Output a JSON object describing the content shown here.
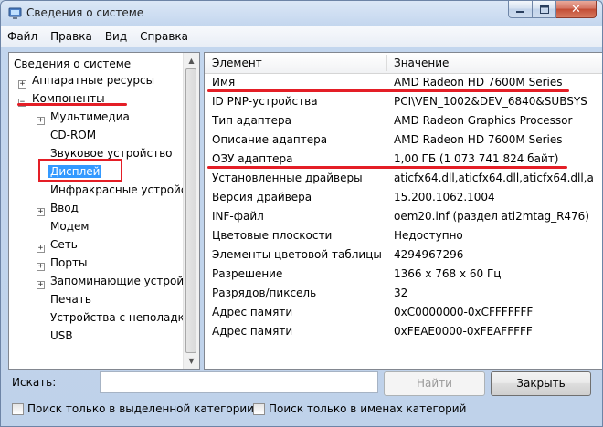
{
  "window": {
    "title": "Сведения о системе",
    "controls": {
      "close": "✕"
    }
  },
  "menu": [
    "Файл",
    "Правка",
    "Вид",
    "Справка"
  ],
  "tree": {
    "items": [
      {
        "label": "Сведения о системе",
        "level": 0,
        "expander": ""
      },
      {
        "label": "Аппаратные ресурсы",
        "level": 1,
        "expander": "+"
      },
      {
        "label": "Компоненты",
        "level": 1,
        "expander": "−"
      },
      {
        "label": "Мультимедиа",
        "level": 2,
        "expander": "+"
      },
      {
        "label": "CD-ROM",
        "level": 2,
        "expander": ""
      },
      {
        "label": "Звуковое устройство",
        "level": 2,
        "expander": ""
      },
      {
        "label": "Дисплей",
        "level": 2,
        "expander": "",
        "selected": true
      },
      {
        "label": "Инфракрасные устройст",
        "level": 2,
        "expander": ""
      },
      {
        "label": "Ввод",
        "level": 2,
        "expander": "+"
      },
      {
        "label": "Модем",
        "level": 2,
        "expander": ""
      },
      {
        "label": "Сеть",
        "level": 2,
        "expander": "+"
      },
      {
        "label": "Порты",
        "level": 2,
        "expander": "+"
      },
      {
        "label": "Запоминающие устройс",
        "level": 2,
        "expander": "+"
      },
      {
        "label": "Печать",
        "level": 2,
        "expander": ""
      },
      {
        "label": "Устройства с неполадка",
        "level": 2,
        "expander": ""
      },
      {
        "label": "USB",
        "level": 2,
        "expander": ""
      }
    ]
  },
  "table": {
    "columns": [
      "Элемент",
      "Значение"
    ],
    "rows": [
      {
        "item": "Имя",
        "value": "AMD Radeon HD 7600M Series"
      },
      {
        "item": "ID PNP-устройства",
        "value": "PCI\\VEN_1002&DEV_6840&SUBSYS"
      },
      {
        "item": "Тип адаптера",
        "value": "AMD Radeon Graphics Processor"
      },
      {
        "item": "Описание адаптера",
        "value": "AMD Radeon HD 7600M Series"
      },
      {
        "item": "ОЗУ адаптера",
        "value": "1,00 ГБ (1 073 741 824 байт)"
      },
      {
        "item": "Установленные драйверы",
        "value": "aticfx64.dll,aticfx64.dll,aticfx64.dll,a"
      },
      {
        "item": "Версия драйвера",
        "value": "15.200.1062.1004"
      },
      {
        "item": "INF-файл",
        "value": "oem20.inf (раздел ati2mtag_R476)"
      },
      {
        "item": "Цветовые плоскости",
        "value": "Недоступно"
      },
      {
        "item": "Элементы цветовой таблицы",
        "value": "4294967296"
      },
      {
        "item": "Разрешение",
        "value": "1366 x 768 x 60 Гц"
      },
      {
        "item": "Разрядов/пиксель",
        "value": "32"
      },
      {
        "item": "Адрес памяти",
        "value": "0xC0000000-0xCFFFFFFF"
      },
      {
        "item": "Адрес памяти",
        "value": "0xFEAE0000-0xFEAFFFFF"
      }
    ]
  },
  "search": {
    "label": "Искать:",
    "value": ""
  },
  "buttons": {
    "find": "Найти",
    "close": "Закрыть"
  },
  "options": {
    "selected_category": "Поиск только в выделенной категории",
    "category_names": "Поиск только в именах категорий"
  },
  "colors": {
    "selection": "#3399ff",
    "annotation": "#e41e26"
  }
}
